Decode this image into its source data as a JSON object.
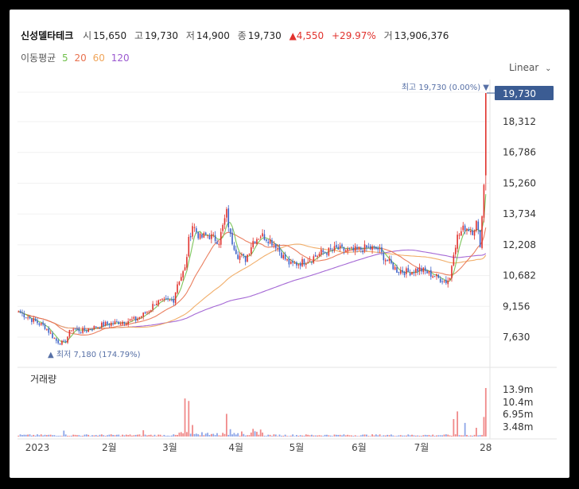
{
  "header": {
    "name": "신성델타테크",
    "open_label": "시",
    "open": "15,650",
    "high_label": "고",
    "high": "19,730",
    "low_label": "저",
    "low": "14,900",
    "close_label": "종",
    "close": "19,730",
    "change": "▲4,550",
    "change_pct": "+29.97%",
    "volume_label": "거",
    "volume": "13,906,376"
  },
  "ma_legend": {
    "label": "이동평균",
    "ma5": "5",
    "ma20": "20",
    "ma60": "60",
    "ma120": "120"
  },
  "scale_select": {
    "value": "Linear",
    "icon": "chevron-down-icon"
  },
  "colors": {
    "up": "#e1322d",
    "down": "#3d62c9",
    "ma5": "#6fbf4a",
    "ma20": "#e8714e",
    "ma60": "#f0a55a",
    "ma120": "#9b59d0",
    "price_badge": "#3b5c93",
    "annot": "#5770a6"
  },
  "chart_data": {
    "type": "candlestick",
    "y_ticks": [
      7630,
      9156,
      10682,
      12208,
      13734,
      15260,
      16786,
      18312
    ],
    "y_tick_labels": [
      "7,630",
      "9,156",
      "10,682",
      "12,208",
      "13,734",
      "15,260",
      "16,786",
      "18,312"
    ],
    "x_tick_labels": [
      "2023",
      "2월",
      "3월",
      "4월",
      "5월",
      "6월",
      "7월",
      "28"
    ],
    "current_price": "19,730",
    "annotations": {
      "high": "최고 19,730 (0.00%) ▼",
      "low": "▲ 최저 7,180 (174.79%)"
    },
    "volume_title": "거래량",
    "volume_ticks": [
      "13.9m",
      "10.4m",
      "6.95m",
      "3.48m"
    ],
    "keypoints": [
      [
        0,
        8900
      ],
      [
        8,
        8450
      ],
      [
        14,
        8150
      ],
      [
        20,
        7450
      ],
      [
        24,
        7300
      ],
      [
        28,
        8050
      ],
      [
        34,
        7950
      ],
      [
        45,
        8250
      ],
      [
        55,
        8400
      ],
      [
        62,
        8500
      ],
      [
        66,
        8750
      ],
      [
        70,
        9050
      ],
      [
        72,
        9350
      ],
      [
        78,
        9400
      ],
      [
        82,
        9500
      ],
      [
        84,
        10300
      ],
      [
        88,
        11000
      ],
      [
        90,
        12400
      ],
      [
        92,
        13200
      ],
      [
        96,
        12550
      ],
      [
        100,
        12700
      ],
      [
        106,
        12400
      ],
      [
        110,
        13800
      ],
      [
        112,
        12600
      ],
      [
        116,
        11700
      ],
      [
        120,
        11500
      ],
      [
        124,
        12400
      ],
      [
        128,
        12700
      ],
      [
        132,
        12500
      ],
      [
        136,
        12200
      ],
      [
        140,
        11600
      ],
      [
        144,
        11200
      ],
      [
        150,
        11350
      ],
      [
        156,
        11600
      ],
      [
        160,
        11800
      ],
      [
        168,
        12000
      ],
      [
        176,
        11900
      ],
      [
        184,
        12050
      ],
      [
        190,
        12000
      ],
      [
        194,
        11500
      ],
      [
        200,
        10950
      ],
      [
        206,
        10850
      ],
      [
        212,
        11000
      ],
      [
        218,
        10750
      ],
      [
        222,
        10550
      ],
      [
        226,
        10400
      ],
      [
        228,
        10550
      ],
      [
        230,
        11900
      ],
      [
        232,
        12600
      ],
      [
        236,
        13100
      ],
      [
        240,
        12900
      ],
      [
        242,
        13300
      ],
      [
        244,
        12300
      ],
      [
        246,
        14900
      ],
      [
        247,
        19730
      ]
    ],
    "volume_spikes": [
      {
        "i": 24,
        "v": 1.7
      },
      {
        "i": 66,
        "v": 1.8
      },
      {
        "i": 88,
        "v": 10.9
      },
      {
        "i": 90,
        "v": 10.2
      },
      {
        "i": 92,
        "v": 3.3
      },
      {
        "i": 110,
        "v": 6.5
      },
      {
        "i": 112,
        "v": 2.1
      },
      {
        "i": 124,
        "v": 2.2
      },
      {
        "i": 128,
        "v": 2.0
      },
      {
        "i": 230,
        "v": 5.0
      },
      {
        "i": 232,
        "v": 7.2
      },
      {
        "i": 236,
        "v": 3.9
      },
      {
        "i": 242,
        "v": 2.5
      },
      {
        "i": 246,
        "v": 5.6
      },
      {
        "i": 247,
        "v": 13.9
      }
    ]
  }
}
